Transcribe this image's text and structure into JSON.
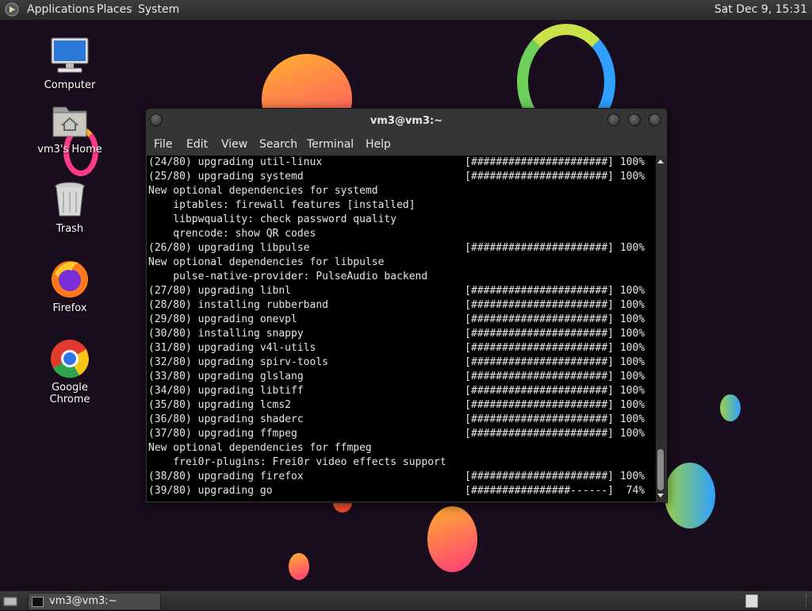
{
  "top_panel": {
    "menus": [
      "Applications",
      "Places",
      "System"
    ],
    "clock": "Sat Dec 9, 15:31"
  },
  "desktop_icons": [
    "Computer",
    "vm3's Home",
    "Trash",
    "Firefox",
    "Google Chrome"
  ],
  "terminal": {
    "title": "vm3@vm3:~",
    "menus": [
      "File",
      "Edit",
      "View",
      "Search",
      "Terminal",
      "Help"
    ],
    "lines": [
      "(24/80) upgrading util-linux                       [######################] 100%",
      "(25/80) upgrading systemd                          [######################] 100%",
      "New optional dependencies for systemd",
      "    iptables: firewall features [installed]",
      "    libpwquality: check password quality",
      "    qrencode: show QR codes",
      "(26/80) upgrading libpulse                         [######################] 100%",
      "New optional dependencies for libpulse",
      "    pulse-native-provider: PulseAudio backend",
      "(27/80) upgrading libnl                            [######################] 100%",
      "(28/80) installing rubberband                      [######################] 100%",
      "(29/80) upgrading onevpl                           [######################] 100%",
      "(30/80) installing snappy                          [######################] 100%",
      "(31/80) upgrading v4l-utils                        [######################] 100%",
      "(32/80) upgrading spirv-tools                      [######################] 100%",
      "(33/80) upgrading glslang                          [######################] 100%",
      "(34/80) upgrading libtiff                          [######################] 100%",
      "(35/80) upgrading lcms2                            [######################] 100%",
      "(36/80) upgrading shaderc                          [######################] 100%",
      "(37/80) upgrading ffmpeg                           [######################] 100%",
      "New optional dependencies for ffmpeg",
      "    frei0r-plugins: Frei0r video effects support",
      "(38/80) upgrading firefox                          [######################] 100%",
      "(39/80) upgrading go                               [################------]  74%"
    ]
  },
  "taskbar": {
    "window_label": "vm3@vm3:~"
  },
  "colors": {
    "wallpaper": "#1a0d1e",
    "panel": "#2b2b2b",
    "terminal_bg": "#000000",
    "terminal_fg": "#e6e6e6"
  }
}
